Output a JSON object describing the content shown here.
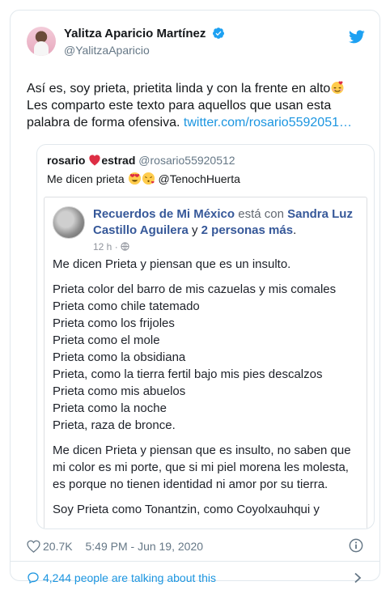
{
  "author": {
    "display_name": "Yalitza Aparicio Martínez",
    "handle": "@YalitzaAparicio"
  },
  "tweet": {
    "line1": "Así es, soy prieta, prietita linda y con la frente en alto",
    "line2": "Les comparto este texto para aquellos que usan esta",
    "line3_text": "palabra de forma ofensiva. ",
    "link": "twitter.com/rosario5592051…"
  },
  "quoted": {
    "name_part1": "rosario ",
    "name_part2": "estrad",
    "handle": "@rosario55920512",
    "text_part1": "Me dicen prieta ",
    "text_part2": " @TenochHuerta"
  },
  "fb_post": {
    "page_name": "Recuerdos de Mi México",
    "with_text": " está con ",
    "tagged_name": "Sandra Luz Castillo Aguilera",
    "and_text": " y ",
    "others": "2 personas más",
    "period": ".",
    "time": "12 h ·",
    "para1": "Me dicen Prieta y piensan que es un insulto.",
    "lines": [
      "Prieta color del barro de mis cazuelas y mis comales",
      "Prieta como chile tatemado",
      "Prieta como los frijoles",
      "Prieta como el mole",
      "Prieta como la obsidiana",
      "Prieta, como la tierra fertil bajo mis pies descalzos",
      "Prieta como mis abuelos",
      "Prieta como la noche",
      "Prieta, raza de bronce."
    ],
    "para3": "Me dicen Prieta y piensan que es insulto, no saben que mi color es mi porte, que si mi piel morena les molesta, es porque no tienen identidad ni amor por su tierra.",
    "para4": "Soy Prieta como Tonantzin, como Coyolxauhqui y"
  },
  "footer": {
    "likes": "20.7K",
    "timestamp": "5:49 PM - Jun 19, 2020",
    "talking": "4,244 people are talking about this"
  },
  "colors": {
    "link": "#1b95e0",
    "fb_link": "#365899",
    "muted": "#657786"
  },
  "icons": {
    "verified": "verified-badge-icon",
    "twitter": "twitter-bird-icon",
    "heart": "heart-icon",
    "info": "info-icon",
    "bubble": "speech-bubble-icon",
    "chevron": "chevron-right-icon"
  }
}
